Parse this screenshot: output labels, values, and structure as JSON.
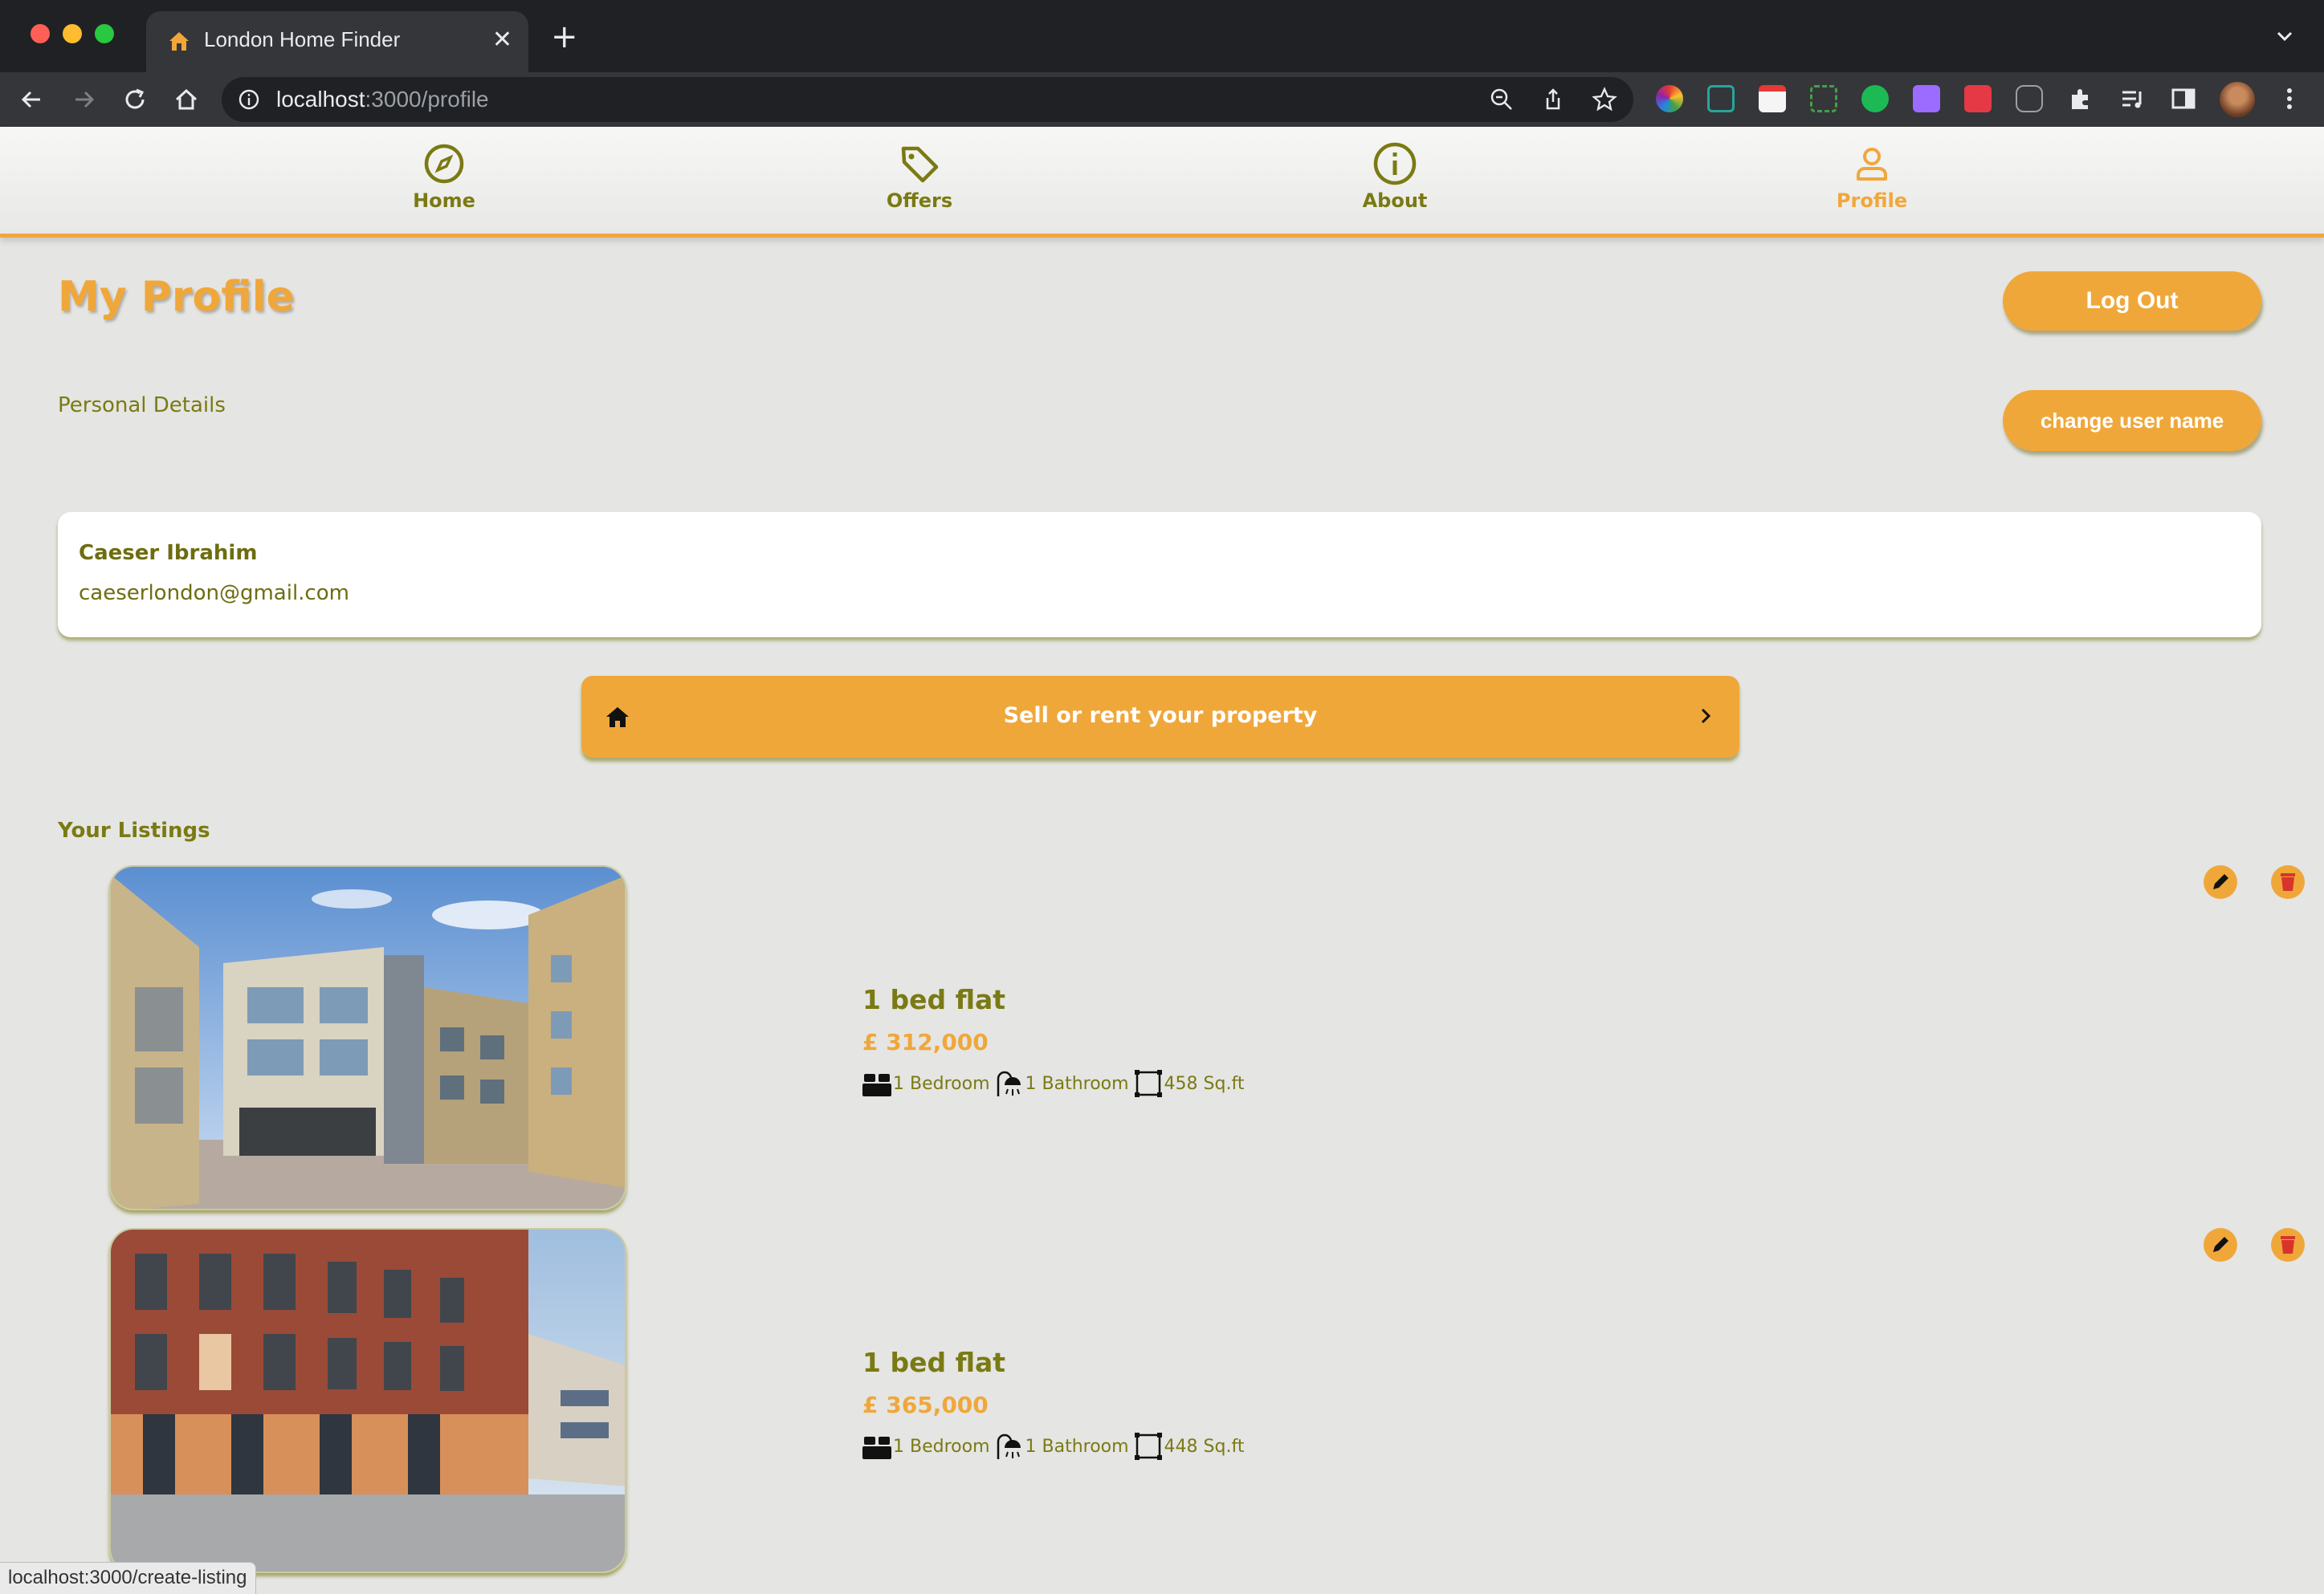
{
  "browser": {
    "tab_title": "London Home Finder",
    "url_host": "localhost",
    "url_path": ":3000/profile",
    "status_url": "localhost:3000/create-listing"
  },
  "nav": {
    "items": [
      {
        "label": "Home",
        "icon": "compass-icon"
      },
      {
        "label": "Offers",
        "icon": "tag-icon"
      },
      {
        "label": "About",
        "icon": "info-icon"
      },
      {
        "label": "Profile",
        "icon": "person-icon",
        "active": true
      }
    ]
  },
  "profile": {
    "title": "My Profile",
    "logout_label": "Log Out",
    "personal_details_label": "Personal Details",
    "change_name_label": "change user name",
    "name": "Caeser Ibrahim",
    "email": "caeserlondon@gmail.com",
    "sell_label": "Sell or rent your property",
    "listings_label": "Your Listings"
  },
  "listings": [
    {
      "title": "1 bed flat",
      "price": "£ 312,000",
      "bedrooms": "1 Bedroom",
      "bathrooms": "1 Bathroom",
      "area": "458 Sq.ft",
      "photo": "modern grey and cream apartment block"
    },
    {
      "title": "1 bed flat",
      "price": "£ 365,000",
      "bedrooms": "1 Bedroom",
      "bathrooms": "1 Bathroom",
      "area": "448 Sq.ft",
      "photo": "red brick apartment block"
    }
  ],
  "colors": {
    "accent": "#f0a73a",
    "olive": "#7a7a14",
    "page_bg": "#e5e5e3",
    "delete": "#d9342b"
  }
}
